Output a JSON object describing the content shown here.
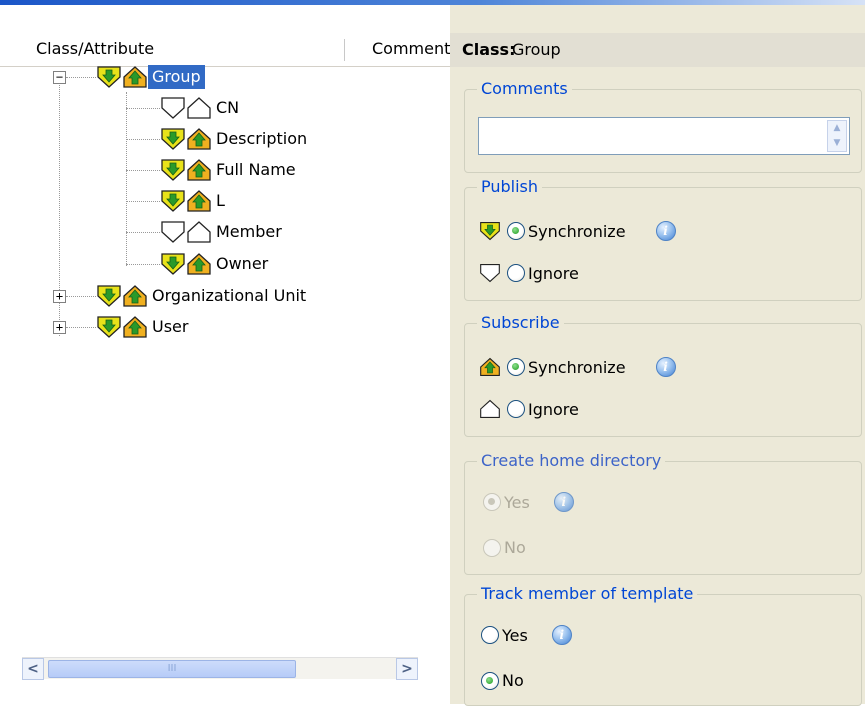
{
  "tree": {
    "columns": [
      "Class/Attribute",
      "Comment"
    ],
    "nodes": [
      {
        "label": "Group",
        "selected": true,
        "expanded": true
      },
      {
        "label": "CN"
      },
      {
        "label": "Description"
      },
      {
        "label": "Full Name"
      },
      {
        "label": "L"
      },
      {
        "label": "Member"
      },
      {
        "label": "Owner"
      },
      {
        "label": "Organizational Unit",
        "expanded": false
      },
      {
        "label": "User",
        "expanded": false
      }
    ],
    "expander_expanded": "−",
    "expander_collapsed": "+",
    "scroll_left": "<",
    "scroll_right": ">",
    "scroll_grip": "III"
  },
  "detail": {
    "class_key": "Class:",
    "class_value": "Group",
    "comments": {
      "title": "Comments",
      "value": ""
    },
    "publish": {
      "title": "Publish",
      "synchronize": "Synchronize",
      "ignore": "Ignore",
      "selected": "Synchronize"
    },
    "subscribe": {
      "title": "Subscribe",
      "synchronize": "Synchronize",
      "ignore": "Ignore",
      "selected": "Synchronize"
    },
    "home_directory": {
      "title": "Create home directory",
      "yes": "Yes",
      "no": "No",
      "selected": "Yes",
      "enabled": false
    },
    "track_member": {
      "title": "Track member of template",
      "yes": "Yes",
      "no": "No",
      "selected": "No"
    },
    "info_glyph": "i"
  },
  "colors": {
    "accent": "#316ac5",
    "group_title": "#0046d5",
    "panel_bg": "#ece9d8",
    "publish_icon": "#e8e21a",
    "subscribe_icon": "#f0b020"
  }
}
